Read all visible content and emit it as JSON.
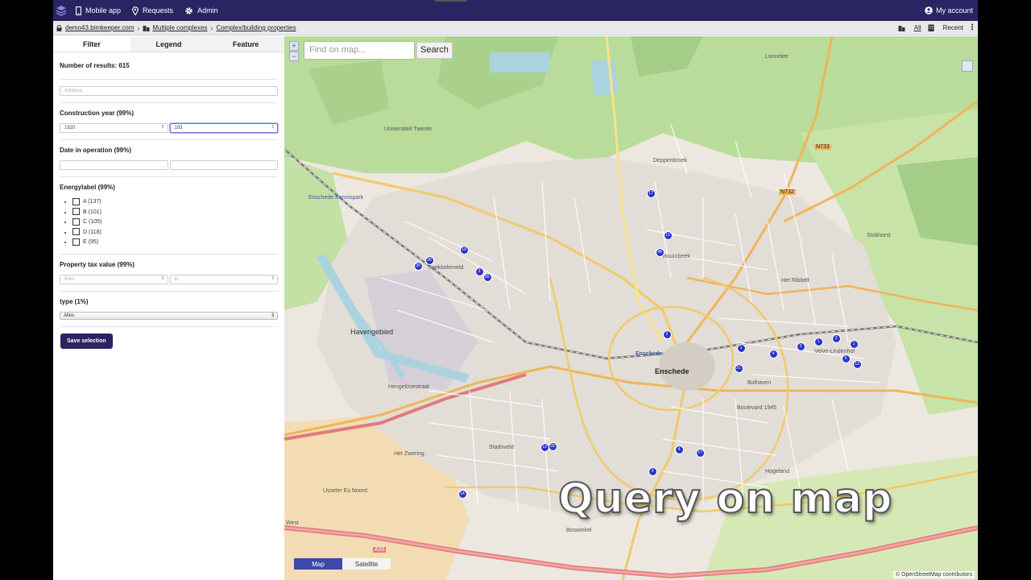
{
  "topnav": {
    "items": [
      {
        "label": "Mobile app",
        "icon": "phone-icon"
      },
      {
        "label": "Requests",
        "icon": "pin-icon"
      },
      {
        "label": "Admin",
        "icon": "gear-icon"
      }
    ],
    "account": "My account"
  },
  "breadcrumb": {
    "items": [
      "demo43.bimkeeper.com",
      "Multiple complexes",
      "Complex/building properties"
    ],
    "all": "All",
    "recent": "Recent"
  },
  "tabs": [
    "Filter",
    "Legend",
    "Feature"
  ],
  "filter": {
    "results_label": "Number of results: 615",
    "address_placeholder": "Address",
    "construction_year": {
      "title": "Construction year (99%)",
      "from": "1920",
      "to": "193"
    },
    "date_in_operation": {
      "title": "Date in operation (99%)"
    },
    "energylabel": {
      "title": "Energylabel (99%)",
      "options": [
        "A (137)",
        "B (101)",
        "C (105)",
        "D (118)",
        "E (95)"
      ]
    },
    "property_tax": {
      "title": "Property tax value (99%)",
      "from_placeholder": "from",
      "to_placeholder": "to"
    },
    "type": {
      "title": "type (1%)",
      "selected": "Alles"
    },
    "save_button": "Save selection"
  },
  "map": {
    "search_placeholder": "Find on map...",
    "search_button": "Search",
    "zoom_in": "+",
    "zoom_out": "−",
    "toggle_map": "Map",
    "toggle_satellite": "Satellite",
    "attribution": "© OpenStreetMap contributors",
    "overlay_caption": "Query on map",
    "clusters": [
      "17",
      "13",
      "48",
      "19",
      "30",
      "28",
      "3",
      "55",
      "2",
      "1",
      "4",
      "3",
      "1",
      "3",
      "1",
      "6",
      "12",
      "21",
      "13",
      "28",
      "4",
      "17",
      "3",
      "14"
    ],
    "labels": {
      "universiteit": "Universiteit Twente",
      "enschede_kennispark": "Enschede Kennispark",
      "havengebied": "Havengebied",
      "enschede": "Enschede",
      "enschede_station": "Enschede",
      "deppenbroek": "Deppenbroek",
      "twekkelerveld": "Twekkelerveld",
      "roombeek": "Roombeek",
      "het_ribbelt": "Het Ribbelt",
      "velve_lindenhof": "Velve-Lindenhof",
      "stadsveld": "Stadsveld",
      "hogeland": "Hogeland",
      "het_zwering": "Het Zwering",
      "usseler_es": "Usseler Es Noord",
      "boswinkel": "Boswinkel",
      "bolhaven": "Bolhaven",
      "lonneker": "Lonneker",
      "stokhorst": "Stokhorst",
      "n733": "N733",
      "n732": "N732",
      "a35": "A35",
      "west": "West",
      "hengelosestraat": "Hengelosestraat",
      "boulevard": "Boulevard 1945"
    }
  }
}
